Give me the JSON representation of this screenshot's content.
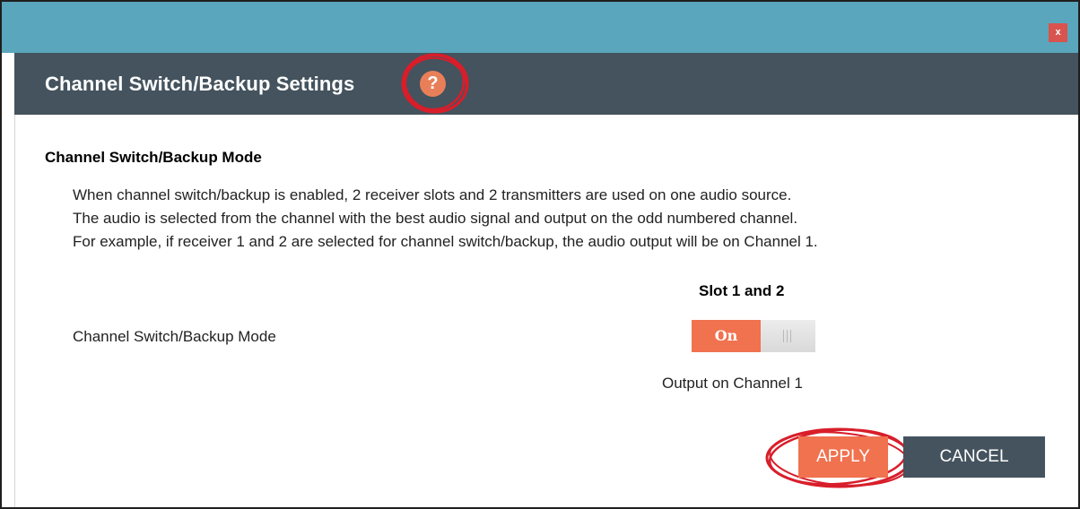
{
  "dialog": {
    "close_label": "x",
    "title": "Channel Switch/Backup Settings",
    "help_label": "?"
  },
  "section": {
    "title": "Channel Switch/Backup Mode",
    "description": [
      "When channel switch/backup is enabled, 2 receiver slots and 2 transmitters are used on one audio source.",
      "The audio is selected from the channel with the best audio signal and output on the odd numbered channel.",
      "For example, if receiver 1 and 2 are selected for channel switch/backup, the audio output will be on Channel 1."
    ]
  },
  "setting": {
    "column_header": "Slot 1 and 2",
    "label": "Channel Switch/Backup Mode",
    "toggle_label": "On",
    "toggle_state": "on",
    "output_note": "Output on Channel 1"
  },
  "buttons": {
    "apply": "APPLY",
    "cancel": "CANCEL"
  },
  "colors": {
    "titlebar": "#5aa6bc",
    "header": "#44535e",
    "accent": "#f0724f",
    "close": "#d9534f",
    "annotation": "#d81e2a"
  },
  "icons": {
    "close": "close-icon",
    "help": "help-icon"
  }
}
